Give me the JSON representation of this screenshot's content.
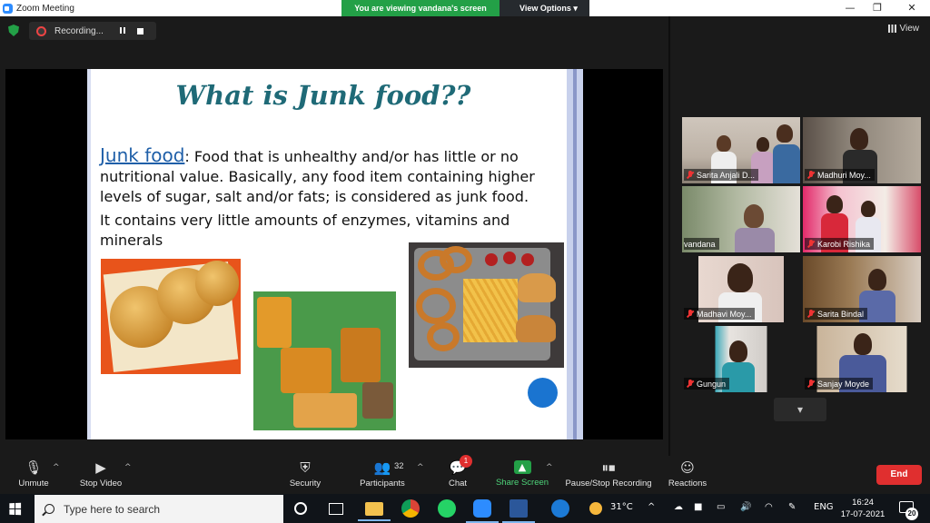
{
  "window": {
    "title": "Zoom Meeting",
    "minimize": "—",
    "restore": "❐",
    "close": "✕"
  },
  "banner": {
    "viewing": "You are viewing vandana's screen",
    "options": "View Options ▾"
  },
  "recording": {
    "label": "Recording..."
  },
  "gallery": {
    "view_label": "View"
  },
  "slide": {
    "title": "What is Junk food??",
    "term": "Junk food",
    "definition": ": Food that is unhealthy and/or has little or no nutritional value. Basically, any food item containing higher levels of sugar, salt and/or fats; is considered as junk food.",
    "detail": "It contains very little amounts of enzymes, vitamins and minerals"
  },
  "participants": [
    {
      "name": "Sarita Anjali D...",
      "muted": true
    },
    {
      "name": "Madhuri Moy...",
      "muted": true
    },
    {
      "name": "vandana",
      "muted": false,
      "active": true
    },
    {
      "name": "Karobi Rishika",
      "muted": true
    },
    {
      "name": "Madhavi Moy...",
      "muted": true
    },
    {
      "name": "Sarita Bindal",
      "muted": true
    },
    {
      "name": "Gungun",
      "muted": true
    },
    {
      "name": "Sanjay Moyde",
      "muted": true
    }
  ],
  "toolbar": {
    "unmute": "Unmute",
    "stop_video": "Stop Video",
    "security": "Security",
    "participants": "Participants",
    "participants_count": "32",
    "chat": "Chat",
    "chat_badge": "1",
    "share_screen": "Share Screen",
    "recording": "Pause/Stop Recording",
    "reactions": "Reactions",
    "end": "End"
  },
  "taskbar": {
    "search_placeholder": "Type here to search",
    "weather": "31°C",
    "language": "ENG",
    "time": "16:24",
    "date": "17-07-2021",
    "notifications": "20"
  },
  "colors": {
    "accent_green": "#23a047",
    "end_red": "#e02f2f",
    "slide_title": "#1f6a77",
    "active_speaker": "#c5e84a"
  }
}
